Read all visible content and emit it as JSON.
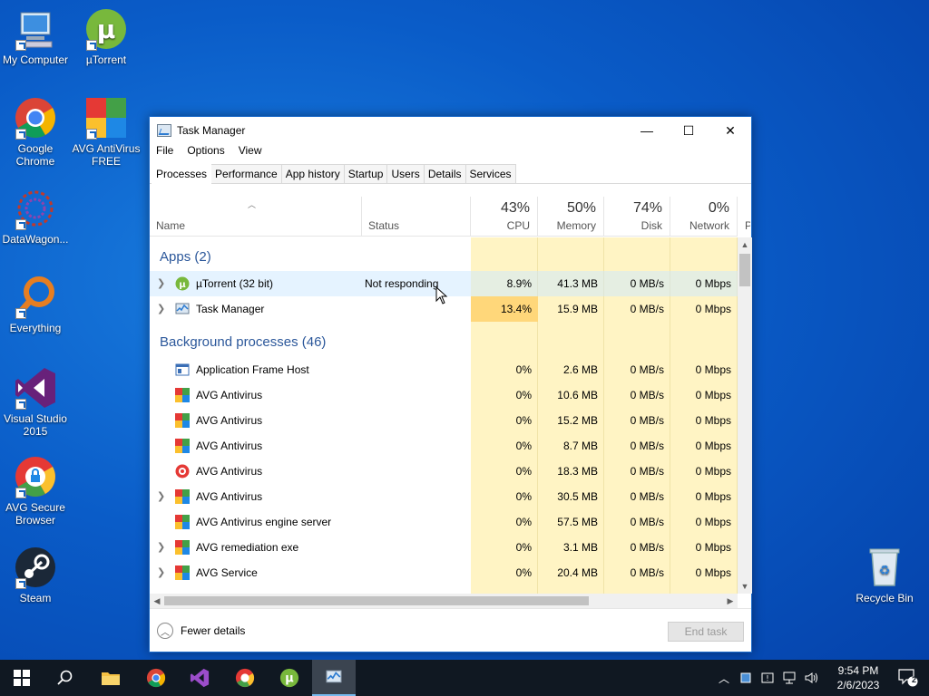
{
  "desktop": {
    "icons": [
      {
        "label": "My Computer",
        "icon": "computer-icon"
      },
      {
        "label": "µTorrent",
        "icon": "utorrent-icon"
      },
      {
        "label": "Google Chrome",
        "icon": "chrome-icon"
      },
      {
        "label": "AVG AntiVirus FREE",
        "icon": "avg-icon"
      },
      {
        "label": "DataWagon...",
        "icon": "datawagon-icon"
      },
      {
        "label": "Everything",
        "icon": "everything-icon"
      },
      {
        "label": "Visual Studio 2015",
        "icon": "visual-studio-icon"
      },
      {
        "label": "AVG Secure Browser",
        "icon": "avg-browser-icon"
      },
      {
        "label": "Steam",
        "icon": "steam-icon"
      },
      {
        "label": "Recycle Bin",
        "icon": "recycle-bin-icon"
      }
    ]
  },
  "window": {
    "title": "Task Manager",
    "controls": {
      "minimize": "—",
      "maximize": "☐",
      "close": "✕"
    },
    "menu": [
      "File",
      "Options",
      "View"
    ],
    "tabs": [
      "Processes",
      "Performance",
      "App history",
      "Startup",
      "Users",
      "Details",
      "Services"
    ],
    "active_tab": "Processes"
  },
  "columns": {
    "name": "Name",
    "status": "Status",
    "cpu": {
      "pct": "43%",
      "label": "CPU"
    },
    "memory": {
      "pct": "50%",
      "label": "Memory"
    },
    "disk": {
      "pct": "74%",
      "label": "Disk"
    },
    "network": {
      "pct": "0%",
      "label": "Network"
    },
    "power_partial": "P"
  },
  "groups": {
    "apps": "Apps (2)",
    "background": "Background processes (46)"
  },
  "apps": [
    {
      "name": "µTorrent (32 bit)",
      "status": "Not responding",
      "cpu": "8.9%",
      "memory": "41.3 MB",
      "disk": "0 MB/s",
      "network": "0 Mbps",
      "expandable": true
    },
    {
      "name": "Task Manager",
      "status": "",
      "cpu": "13.4%",
      "memory": "15.9 MB",
      "disk": "0 MB/s",
      "network": "0 Mbps",
      "expandable": true
    }
  ],
  "background": [
    {
      "name": "Application Frame Host",
      "cpu": "0%",
      "memory": "2.6 MB",
      "disk": "0 MB/s",
      "network": "0 Mbps",
      "expandable": false
    },
    {
      "name": "AVG Antivirus",
      "cpu": "0%",
      "memory": "10.6 MB",
      "disk": "0 MB/s",
      "network": "0 Mbps",
      "expandable": false
    },
    {
      "name": "AVG Antivirus",
      "cpu": "0%",
      "memory": "15.2 MB",
      "disk": "0 MB/s",
      "network": "0 Mbps",
      "expandable": false
    },
    {
      "name": "AVG Antivirus",
      "cpu": "0%",
      "memory": "8.7 MB",
      "disk": "0 MB/s",
      "network": "0 Mbps",
      "expandable": false
    },
    {
      "name": "AVG Antivirus",
      "cpu": "0%",
      "memory": "18.3 MB",
      "disk": "0 MB/s",
      "network": "0 Mbps",
      "expandable": false
    },
    {
      "name": "AVG Antivirus",
      "cpu": "0%",
      "memory": "30.5 MB",
      "disk": "0 MB/s",
      "network": "0 Mbps",
      "expandable": true
    },
    {
      "name": "AVG Antivirus engine server",
      "cpu": "0%",
      "memory": "57.5 MB",
      "disk": "0 MB/s",
      "network": "0 Mbps",
      "expandable": false
    },
    {
      "name": "AVG remediation exe",
      "cpu": "0%",
      "memory": "3.1 MB",
      "disk": "0 MB/s",
      "network": "0 Mbps",
      "expandable": true
    },
    {
      "name": "AVG Service",
      "cpu": "0%",
      "memory": "20.4 MB",
      "disk": "0 MB/s",
      "network": "0 Mbps",
      "expandable": true
    }
  ],
  "footer": {
    "fewer_details": "Fewer details",
    "end_task": "End task"
  },
  "taskbar": {
    "clock_time": "9:54 PM",
    "clock_date": "2/6/2023",
    "notification_count": "2"
  },
  "colors": {
    "accent": "#2b579a",
    "heat_light": "#fff4c4",
    "heat_med": "#ffd77a",
    "desktop_bg": "#0a5cc8"
  }
}
